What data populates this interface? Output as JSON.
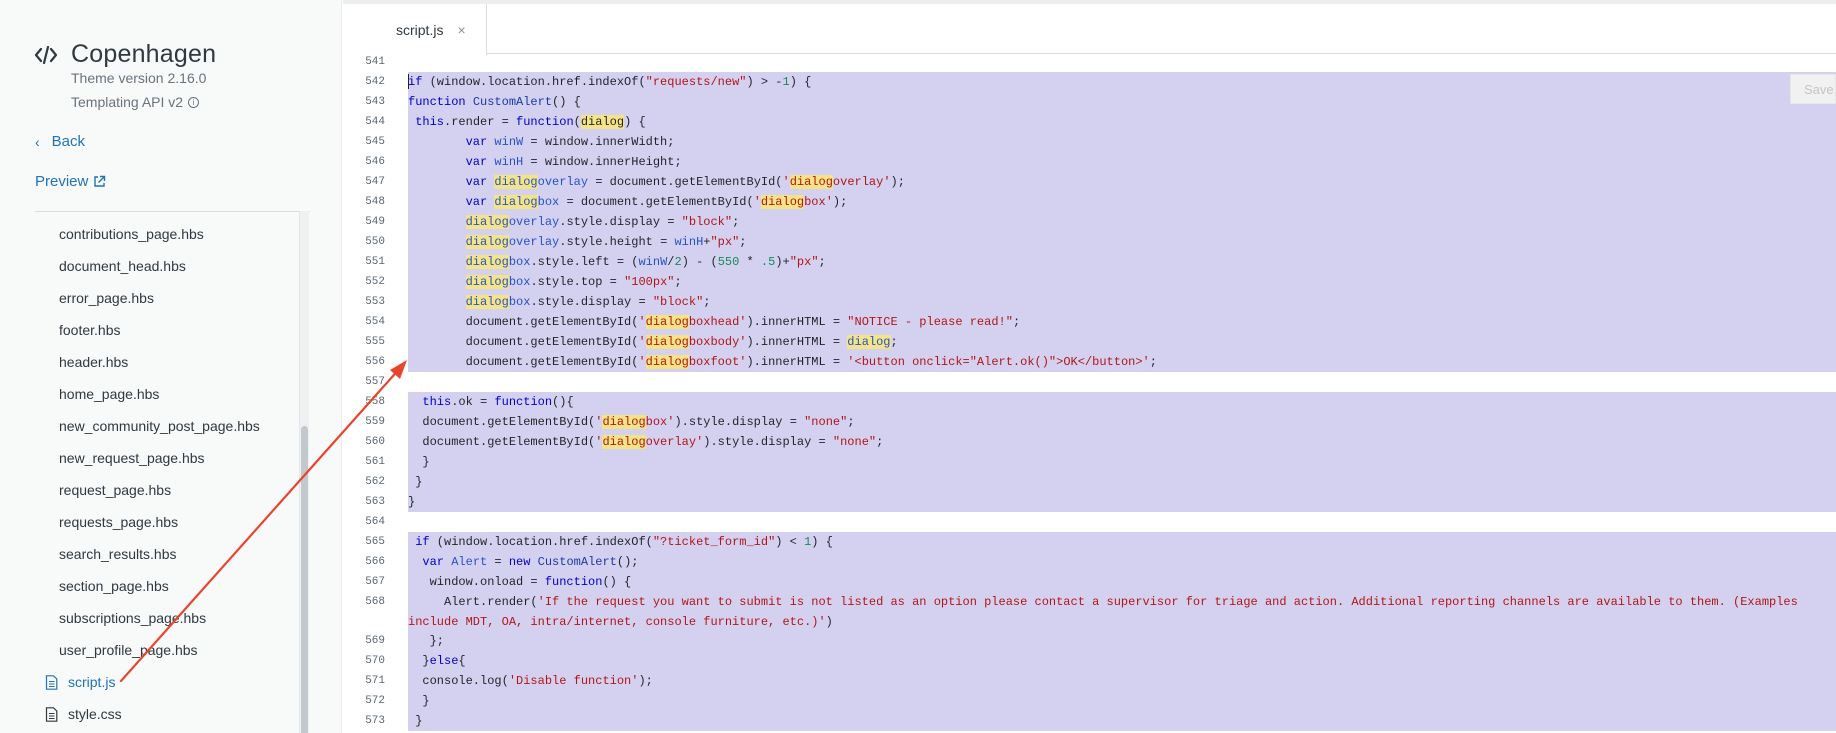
{
  "theme": {
    "name": "Copenhagen",
    "version": "Theme version 2.16.0",
    "api": "Templating API v2"
  },
  "nav": {
    "back": "Back",
    "preview": "Preview"
  },
  "files": [
    {
      "name": "contributions_page.hbs",
      "indent": "nested",
      "icon": "none",
      "active": false
    },
    {
      "name": "document_head.hbs",
      "indent": "nested",
      "icon": "none",
      "active": false
    },
    {
      "name": "error_page.hbs",
      "indent": "nested",
      "icon": "none",
      "active": false
    },
    {
      "name": "footer.hbs",
      "indent": "nested",
      "icon": "none",
      "active": false
    },
    {
      "name": "header.hbs",
      "indent": "nested",
      "icon": "none",
      "active": false
    },
    {
      "name": "home_page.hbs",
      "indent": "nested",
      "icon": "none",
      "active": false
    },
    {
      "name": "new_community_post_page.hbs",
      "indent": "nested",
      "icon": "none",
      "active": false
    },
    {
      "name": "new_request_page.hbs",
      "indent": "nested",
      "icon": "none",
      "active": false
    },
    {
      "name": "request_page.hbs",
      "indent": "nested",
      "icon": "none",
      "active": false
    },
    {
      "name": "requests_page.hbs",
      "indent": "nested",
      "icon": "none",
      "active": false
    },
    {
      "name": "search_results.hbs",
      "indent": "nested",
      "icon": "none",
      "active": false
    },
    {
      "name": "section_page.hbs",
      "indent": "nested",
      "icon": "none",
      "active": false
    },
    {
      "name": "subscriptions_page.hbs",
      "indent": "nested",
      "icon": "none",
      "active": false
    },
    {
      "name": "user_profile_page.hbs",
      "indent": "nested",
      "icon": "none",
      "active": false
    },
    {
      "name": "script.js",
      "indent": "root",
      "icon": "document-icon",
      "active": true
    },
    {
      "name": "style.css",
      "indent": "root",
      "icon": "document-icon",
      "active": false
    }
  ],
  "editor": {
    "tab_label": "script.js",
    "tab_close": "×",
    "save_label": "Save"
  },
  "code_lines": [
    {
      "n": "541",
      "sel": false,
      "html": ""
    },
    {
      "n": "542",
      "sel": true,
      "html": "<span class=\"cursor\"></span><span class=\"k\">if</span> (window.location.href.indexOf(<span class=\"s\">\"requests/new\"</span>) &gt; -<span class=\"n\">1</span>) {"
    },
    {
      "n": "543",
      "sel": true,
      "html": "<span class=\"k\">function</span> <span class=\"fn\">CustomAlert</span>() {"
    },
    {
      "n": "544",
      "sel": true,
      "html": " <span class=\"k\">this</span>.render = <span class=\"k\">function</span>(<span class=\"hl\">dialog</span>) {"
    },
    {
      "n": "545",
      "sel": true,
      "html": "        <span class=\"k\">var</span> <span class=\"v\">winW</span> = window.innerWidth;"
    },
    {
      "n": "546",
      "sel": true,
      "html": "        <span class=\"k\">var</span> <span class=\"v\">winH</span> = window.innerHeight;"
    },
    {
      "n": "547",
      "sel": true,
      "html": "        <span class=\"k\">var</span> <span class=\"v\"><span class=\"hl\">dialog</span>overlay</span> = document.getElementById(<span class=\"s\">'<span class=\"hl\">dialog</span>overlay'</span>);"
    },
    {
      "n": "548",
      "sel": true,
      "html": "        <span class=\"k\">var</span> <span class=\"v\"><span class=\"hl\">dialog</span>box</span> = document.getElementById(<span class=\"s\">'<span class=\"hl\">dialog</span>box'</span>);"
    },
    {
      "n": "549",
      "sel": true,
      "html": "        <span class=\"v\"><span class=\"hl\">dialog</span>overlay</span>.style.display = <span class=\"s\">\"block\"</span>;"
    },
    {
      "n": "550",
      "sel": true,
      "html": "        <span class=\"v\"><span class=\"hl\">dialog</span>overlay</span>.style.height = <span class=\"v\">winH</span>+<span class=\"s\">\"px\"</span>;"
    },
    {
      "n": "551",
      "sel": true,
      "html": "        <span class=\"v\"><span class=\"hl\">dialog</span>box</span>.style.left = (<span class=\"v\">winW</span>/<span class=\"n\">2</span>) - (<span class=\"n\">550</span> * <span class=\"n\">.5</span>)+<span class=\"s\">\"px\"</span>;"
    },
    {
      "n": "552",
      "sel": true,
      "html": "        <span class=\"v\"><span class=\"hl\">dialog</span>box</span>.style.top = <span class=\"s\">\"100px\"</span>;"
    },
    {
      "n": "553",
      "sel": true,
      "html": "        <span class=\"v\"><span class=\"hl\">dialog</span>box</span>.style.display = <span class=\"s\">\"block\"</span>;"
    },
    {
      "n": "554",
      "sel": true,
      "html": "        document.getElementById(<span class=\"s\">'<span class=\"hl\">dialog</span>boxhead'</span>).innerHTML = <span class=\"s\">\"NOTICE - please read!\"</span>;"
    },
    {
      "n": "555",
      "sel": true,
      "html": "        document.getElementById(<span class=\"s\">'<span class=\"hl\">dialog</span>boxbody'</span>).innerHTML = <span class=\"v\"><span class=\"hl\">dialog</span></span>;"
    },
    {
      "n": "556",
      "sel": true,
      "html": "        document.getElementById(<span class=\"s\">'<span class=\"hl\">dialog</span>boxfoot'</span>).innerHTML = <span class=\"s\">'&lt;button onclick=\"Alert.ok()\"&gt;OK&lt;/button&gt;'</span>;"
    },
    {
      "n": "557",
      "sel": true,
      "html": ""
    },
    {
      "n": "558",
      "sel": true,
      "html": "  <span class=\"k\">this</span>.ok = <span class=\"k\">function</span>(){"
    },
    {
      "n": "559",
      "sel": true,
      "html": "  document.getElementById(<span class=\"s\">'<span class=\"hl\">dialog</span>box'</span>).style.display = <span class=\"s\">\"none\"</span>;"
    },
    {
      "n": "560",
      "sel": true,
      "html": "  document.getElementById(<span class=\"s\">'<span class=\"hl\">dialog</span>overlay'</span>).style.display = <span class=\"s\">\"none\"</span>;"
    },
    {
      "n": "561",
      "sel": true,
      "html": "  }"
    },
    {
      "n": "562",
      "sel": true,
      "html": " }"
    },
    {
      "n": "563",
      "sel": true,
      "html": "}"
    },
    {
      "n": "564",
      "sel": true,
      "html": ""
    },
    {
      "n": "565",
      "sel": true,
      "html": " <span class=\"k\">if</span> (window.location.href.indexOf(<span class=\"s\">\"?ticket_form_id\"</span>) &lt; <span class=\"n\">1</span>) {"
    },
    {
      "n": "566",
      "sel": true,
      "html": "  <span class=\"k\">var</span> <span class=\"v\">Alert</span> = <span class=\"k\">new</span> <span class=\"fn\">CustomAlert</span>();"
    },
    {
      "n": "567",
      "sel": true,
      "html": "   window.onload = <span class=\"k\">function</span>() {"
    },
    {
      "n": "568",
      "sel": true,
      "wrap": true,
      "html": "     Alert.render(<span class=\"s\">'If the request you want to submit is not listed as an option please contact a supervisor for triage and action. Additional reporting channels are available to them. (Examples</span><span class=\"cont\"><span class=\"s\">include MDT, OA, intra/internet, console furniture, etc.)'</span>)</span>"
    },
    {
      "n": "569",
      "sel": true,
      "html": "   };"
    },
    {
      "n": "570",
      "sel": true,
      "html": "  }<span class=\"k\">else</span>{"
    },
    {
      "n": "571",
      "sel": true,
      "html": "  console.log(<span class=\"s\">'Disable function'</span>);"
    },
    {
      "n": "572",
      "sel": true,
      "html": "  }"
    },
    {
      "n": "573",
      "sel": true,
      "html": " }"
    }
  ],
  "colors": {
    "accent": "#1f73b7",
    "selection": "#d4d1f0",
    "match_highlight": "#f5e487",
    "annotation_arrow": "#e8452c"
  }
}
